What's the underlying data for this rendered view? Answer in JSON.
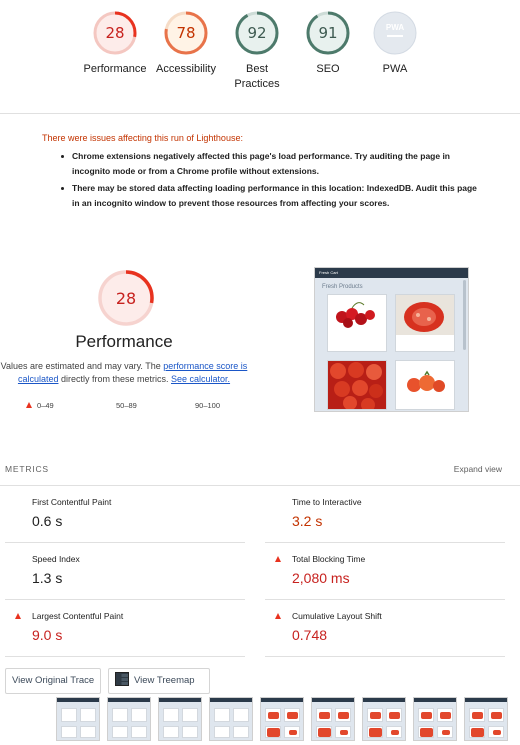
{
  "gauges": [
    {
      "name": "performance",
      "value": "28",
      "label": "Performance",
      "score": 0.28,
      "color": "#e8321f",
      "bg": "#fdecea"
    },
    {
      "name": "accessibility",
      "value": "78",
      "label": "Accessibility",
      "score": 0.78,
      "color": "#e8734a",
      "bg": "#fff3e6"
    },
    {
      "name": "best-practices",
      "value": "92",
      "label": "Best\nPractices",
      "score": 0.92,
      "color": "#4d7a6b",
      "bg": "#e8f1ee"
    },
    {
      "name": "seo",
      "value": "91",
      "label": "SEO",
      "score": 0.91,
      "color": "#4d7a6b",
      "bg": "#e8f1ee"
    },
    {
      "name": "pwa",
      "value": "PWA",
      "label": "PWA",
      "score": 0,
      "color": "#c8d1dc",
      "bg": "#e4e9ef"
    }
  ],
  "warnings": {
    "title": "There were issues affecting this run of Lighthouse:",
    "items": [
      "Chrome extensions negatively affected this page's load performance. Try auditing the page in incognito mode or from a Chrome profile without extensions.",
      "There may be stored data affecting loading performance in this location: IndexedDB. Audit this page in an incognito window to prevent those resources from affecting your scores."
    ]
  },
  "performance": {
    "score": "28",
    "score_fraction": 0.28,
    "title": "Performance",
    "desc_before": "Values are estimated and may vary. The ",
    "desc_link1": "performance score is calculated",
    "desc_mid": " directly from these metrics. ",
    "desc_link2": "See calculator.",
    "legend": [
      "0–49",
      "50–89",
      "90–100"
    ]
  },
  "screenshot": {
    "bar_text": "Fresh Cart",
    "title": "Fresh Products"
  },
  "metrics": {
    "header": "METRICS",
    "expand": "Expand view",
    "items": [
      {
        "name": "First Contentful Paint",
        "value": "0.6 s",
        "status": "good"
      },
      {
        "name": "Time to Interactive",
        "value": "3.2 s",
        "status": "average"
      },
      {
        "name": "Speed Index",
        "value": "1.3 s",
        "status": "good"
      },
      {
        "name": "Total Blocking Time",
        "value": "2,080 ms",
        "status": "fail"
      },
      {
        "name": "Largest Contentful Paint",
        "value": "9.0 s",
        "status": "fail"
      },
      {
        "name": "Cumulative Layout Shift",
        "value": "0.748",
        "status": "fail"
      }
    ]
  },
  "buttons": {
    "trace": "View Original Trace",
    "treemap": "View Treemap"
  },
  "colors": {
    "fail": "#e8321f",
    "average": "#c33300",
    "link": "#1a56c7"
  }
}
